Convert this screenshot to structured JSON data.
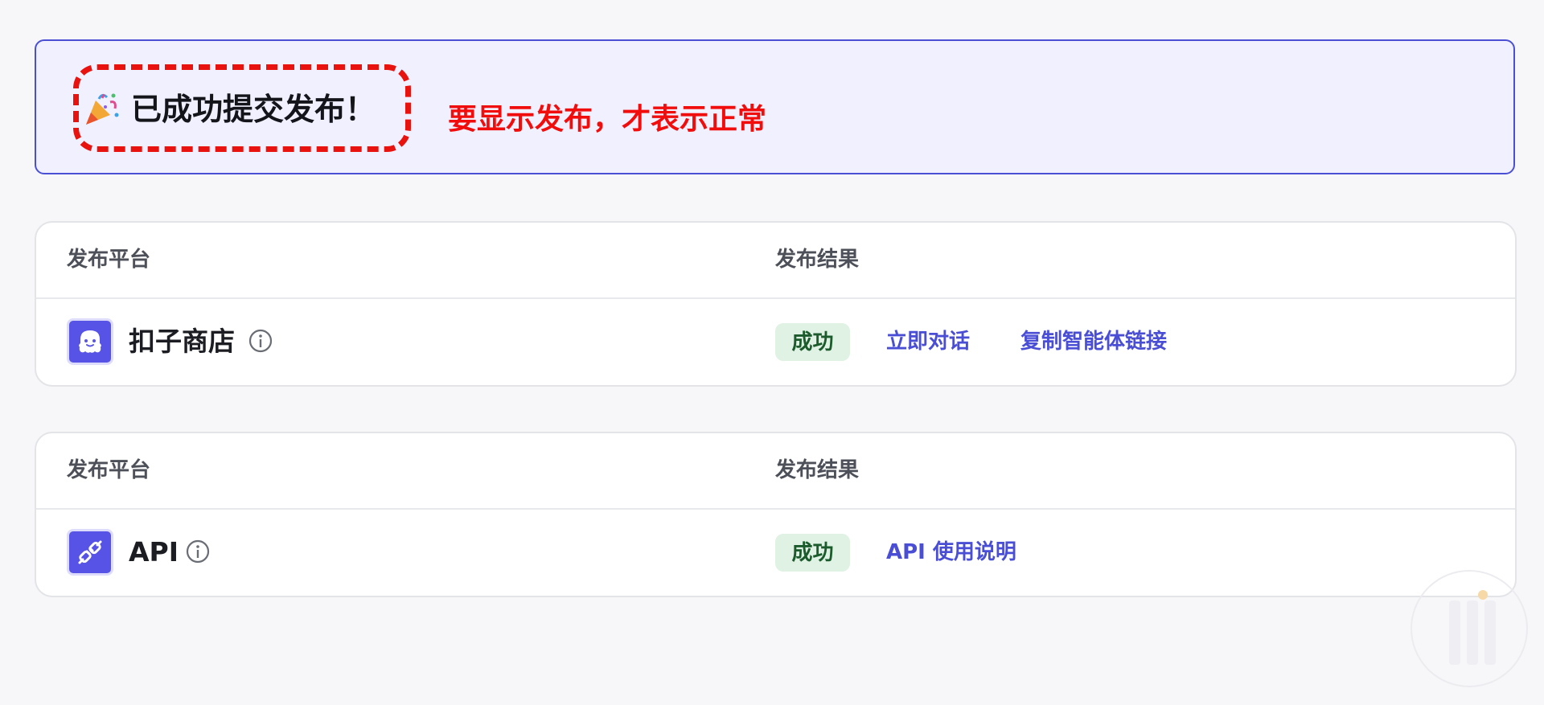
{
  "banner": {
    "emoji": "🎉",
    "title": "已成功提交发布！",
    "annotation": "要显示发布，才表示正常"
  },
  "cards": [
    {
      "header": {
        "platform": "发布平台",
        "result": "发布结果"
      },
      "platform": {
        "name": "扣子商店",
        "icon": "ghost-store-icon"
      },
      "status": "成功",
      "links": [
        "立即对话",
        "复制智能体链接"
      ]
    },
    {
      "header": {
        "platform": "发布平台",
        "result": "发布结果"
      },
      "platform": {
        "name": "API",
        "icon": "plug-api-icon"
      },
      "status": "成功",
      "links": [
        "API 使用说明"
      ]
    }
  ],
  "colors": {
    "accent": "#4a4ed5",
    "banner_bg": "#f0f0fe",
    "annotation_red": "#f20d0d",
    "success_bg": "#dff2e3",
    "success_text": "#1b5b2c"
  }
}
